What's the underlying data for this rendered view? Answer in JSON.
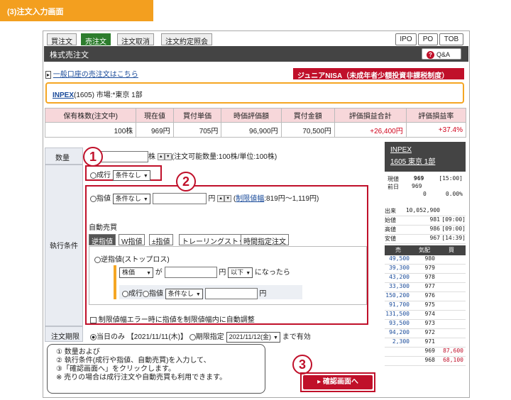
{
  "header": {
    "title": "(3)注文入力画面"
  },
  "tabs": [
    "買注文",
    "売注文",
    "注文取消",
    "注文約定照会"
  ],
  "right_tabs": [
    "IPO",
    "PO",
    "TOB"
  ],
  "titlebar": {
    "title": "株式売注文",
    "qa": "Q&A"
  },
  "links": {
    "general": "一般口座の売注文はこちら",
    "nisa": "ジュニアNISA（未成年者少額投資非課税制度）"
  },
  "stock": {
    "name": "INPEX",
    "rest": "(1605) 市場:*東京 1部"
  },
  "holdings": {
    "headers": [
      "保有株数(注文中)",
      "現在値",
      "買付単価",
      "時価評価額",
      "買付金額",
      "評価損益合計",
      "評価損益率"
    ],
    "values": [
      "100株",
      "969円",
      "705円",
      "96,900円",
      "70,500円",
      "+26,400円",
      "+37.4%"
    ]
  },
  "order": {
    "qty_label": "数量",
    "qty_unit": "株",
    "qty_note": "(注文可能数量:100株/単位:100株)",
    "cond_label": "執行条件",
    "market": "成行",
    "market_opt": "条件なし",
    "limit": "指値",
    "limit_opt": "条件なし",
    "limit_unit": "円",
    "range_link": "制限値幅",
    "range_text": ":819円〜1,119円)",
    "range_open": "(",
    "auto_label": "自動売買",
    "auto_tabs": [
      "逆指値",
      "W指値",
      "±指値",
      "トレーリングストップ",
      "時間指定注文"
    ],
    "stop_label": "逆指値(ストップロス)",
    "stop_base": "株価",
    "stop_ga": "が",
    "stop_unit": "円",
    "stop_cmp": "以下",
    "stop_then": "になったら",
    "stop_market": "成行",
    "stop_limit": "指値",
    "stop_opt": "条件なし",
    "stop_limit_unit": "円",
    "adjust": "制限値幅エラー時に指値を制限値幅内に自動調整",
    "period_label": "注文期限",
    "today": "当日のみ",
    "today_date": "【2021/11/11(木)】",
    "period_spec": "期限指定",
    "period_date": "2021/11/12(金)",
    "period_until": "まで有効"
  },
  "board": {
    "code": "INPEX",
    "code2": "1605 東京 1部",
    "price_lbl": "現値",
    "price": "969",
    "price_time": "[15:00]",
    "prev_lbl": "前日",
    "prev": "969",
    "chg": "0",
    "chg_pct": "0.00%",
    "stats": [
      [
        "出来",
        "10,052,900",
        ""
      ],
      [
        "始値",
        "981",
        "[09:00]"
      ],
      [
        "高値",
        "986",
        "[09:00]"
      ],
      [
        "安値",
        "967",
        "[14:39]"
      ]
    ],
    "cols": [
      "売",
      "気配",
      "買"
    ],
    "rows": [
      [
        "49,500",
        "980",
        ""
      ],
      [
        "39,300",
        "979",
        ""
      ],
      [
        "43,200",
        "978",
        ""
      ],
      [
        "33,300",
        "977",
        ""
      ],
      [
        "150,200",
        "976",
        ""
      ],
      [
        "91,700",
        "975",
        ""
      ],
      [
        "131,500",
        "974",
        ""
      ],
      [
        "93,500",
        "973",
        ""
      ],
      [
        "94,200",
        "972",
        ""
      ],
      [
        "2,300",
        "971",
        ""
      ],
      [
        "",
        "969",
        "87,600"
      ],
      [
        "",
        "968",
        "68,100"
      ]
    ]
  },
  "note": {
    "lines": [
      "① 数量および",
      "② 執行条件(成行や指値、自動売買)を入力して、",
      "③「確認画面へ」をクリックします。",
      "※ 売りの場合は成行注文や自動売買も利用できます。"
    ]
  },
  "confirm": "確認画面へ",
  "markers": [
    "1",
    "2",
    "3"
  ],
  "colors": {
    "accent": "#c0102a",
    "header": "#f39f1f",
    "tab_active": "#2d7d2d"
  }
}
